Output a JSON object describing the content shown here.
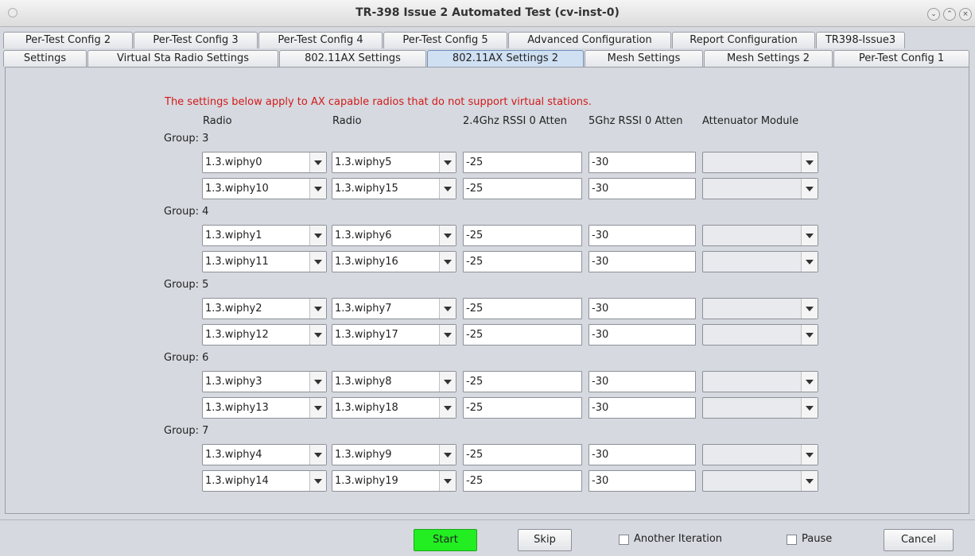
{
  "window": {
    "title": "TR-398 Issue 2 Automated Test  (cv-inst-0)",
    "controls": [
      "minimize-icon",
      "maximize-icon",
      "close-icon"
    ]
  },
  "tabs": {
    "row_back": [
      "Per-Test Config 2",
      "Per-Test Config 3",
      "Per-Test Config 4",
      "Per-Test Config 5",
      "Advanced Configuration",
      "Report Configuration",
      "TR398-Issue3"
    ],
    "row_front": [
      "Settings",
      "Virtual Sta Radio Settings",
      "802.11AX Settings",
      "802.11AX Settings 2",
      "Mesh Settings",
      "Mesh Settings 2",
      "Per-Test Config 1"
    ],
    "active": "802.11AX Settings 2"
  },
  "content": {
    "notice": "The settings below apply to AX capable radios that do not support virtual stations.",
    "headers": {
      "radio1": "Radio",
      "radio2": "Radio",
      "rssi24": "2.4Ghz RSSI 0 Atten",
      "rssi5": "5Ghz RSSI 0 Atten",
      "attenuator": "Attenuator Module"
    },
    "groups": [
      {
        "label": "Group: 3",
        "rows": [
          {
            "radio1": "1.3.wiphy0",
            "radio2": "1.3.wiphy5",
            "rssi24": "-25",
            "rssi5": "-30",
            "atten": ""
          },
          {
            "radio1": "1.3.wiphy10",
            "radio2": "1.3.wiphy15",
            "rssi24": "-25",
            "rssi5": "-30",
            "atten": ""
          }
        ]
      },
      {
        "label": "Group: 4",
        "rows": [
          {
            "radio1": "1.3.wiphy1",
            "radio2": "1.3.wiphy6",
            "rssi24": "-25",
            "rssi5": "-30",
            "atten": ""
          },
          {
            "radio1": "1.3.wiphy11",
            "radio2": "1.3.wiphy16",
            "rssi24": "-25",
            "rssi5": "-30",
            "atten": ""
          }
        ]
      },
      {
        "label": "Group: 5",
        "rows": [
          {
            "radio1": "1.3.wiphy2",
            "radio2": "1.3.wiphy7",
            "rssi24": "-25",
            "rssi5": "-30",
            "atten": ""
          },
          {
            "radio1": "1.3.wiphy12",
            "radio2": "1.3.wiphy17",
            "rssi24": "-25",
            "rssi5": "-30",
            "atten": ""
          }
        ]
      },
      {
        "label": "Group: 6",
        "rows": [
          {
            "radio1": "1.3.wiphy3",
            "radio2": "1.3.wiphy8",
            "rssi24": "-25",
            "rssi5": "-30",
            "atten": ""
          },
          {
            "radio1": "1.3.wiphy13",
            "radio2": "1.3.wiphy18",
            "rssi24": "-25",
            "rssi5": "-30",
            "atten": ""
          }
        ]
      },
      {
        "label": "Group: 7",
        "rows": [
          {
            "radio1": "1.3.wiphy4",
            "radio2": "1.3.wiphy9",
            "rssi24": "-25",
            "rssi5": "-30",
            "atten": ""
          },
          {
            "radio1": "1.3.wiphy14",
            "radio2": "1.3.wiphy19",
            "rssi24": "-25",
            "rssi5": "-30",
            "atten": ""
          }
        ]
      }
    ]
  },
  "bottom": {
    "start": "Start",
    "skip": "Skip",
    "another_iteration": "Another Iteration",
    "another_iteration_checked": false,
    "pause": "Pause",
    "pause_checked": false,
    "cancel": "Cancel"
  },
  "colors": {
    "notice": "#d11a1a",
    "start_button": "#22ee22",
    "active_tab": "#cfe0f3"
  }
}
